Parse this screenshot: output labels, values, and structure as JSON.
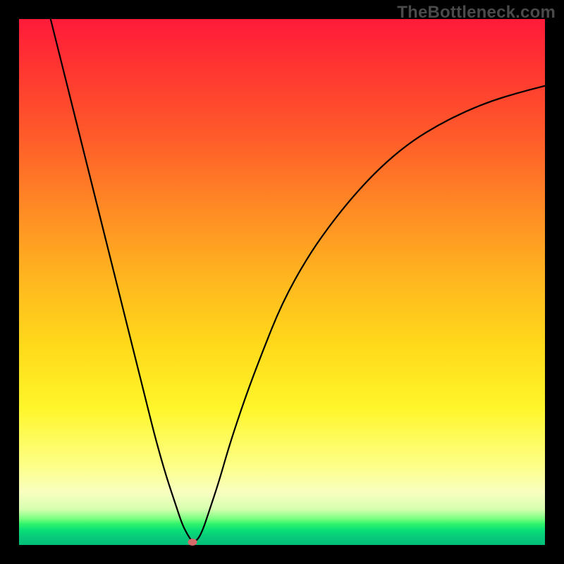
{
  "watermark": "TheBottleneck.com",
  "colors": {
    "frame_bg": "#000000",
    "curve_stroke": "#000000",
    "marker_fill": "#d46a6a"
  },
  "chart_data": {
    "type": "line",
    "title": "",
    "xlabel": "",
    "ylabel": "",
    "xlim": [
      0,
      100
    ],
    "ylim": [
      0,
      100
    ],
    "grid": false,
    "legend": false,
    "series": [
      {
        "name": "curve",
        "x": [
          6,
          8,
          10,
          12,
          14,
          16,
          18,
          20,
          22,
          24,
          26,
          28,
          30,
          31,
          32,
          33,
          34,
          35,
          36,
          38,
          40,
          43,
          46,
          50,
          55,
          60,
          65,
          70,
          75,
          80,
          85,
          90,
          95,
          100
        ],
        "y": [
          100,
          92,
          84,
          76,
          68,
          60,
          52,
          44,
          36,
          28,
          20,
          13,
          7,
          4,
          2,
          0.5,
          1,
          3,
          6,
          12,
          19,
          28,
          36,
          46,
          55,
          62,
          68,
          73,
          77,
          80,
          82.5,
          84.5,
          86,
          87.3
        ]
      }
    ],
    "marker": {
      "x": 33,
      "y": 0.5
    },
    "background_gradient_stops": [
      {
        "pos": 0,
        "color": "#ff1a3a"
      },
      {
        "pos": 10,
        "color": "#ff3730"
      },
      {
        "pos": 22,
        "color": "#ff5a2a"
      },
      {
        "pos": 36,
        "color": "#ff8a24"
      },
      {
        "pos": 50,
        "color": "#ffb81f"
      },
      {
        "pos": 62,
        "color": "#ffd91a"
      },
      {
        "pos": 74,
        "color": "#fff62a"
      },
      {
        "pos": 85,
        "color": "#fdff88"
      },
      {
        "pos": 90,
        "color": "#f8ffc0"
      },
      {
        "pos": 93.2,
        "color": "#d6ffb0"
      },
      {
        "pos": 95,
        "color": "#7bff82"
      },
      {
        "pos": 96,
        "color": "#30f36a"
      },
      {
        "pos": 97.2,
        "color": "#0adf78"
      },
      {
        "pos": 98.5,
        "color": "#08c97a"
      },
      {
        "pos": 100,
        "color": "#00c07a"
      }
    ]
  }
}
